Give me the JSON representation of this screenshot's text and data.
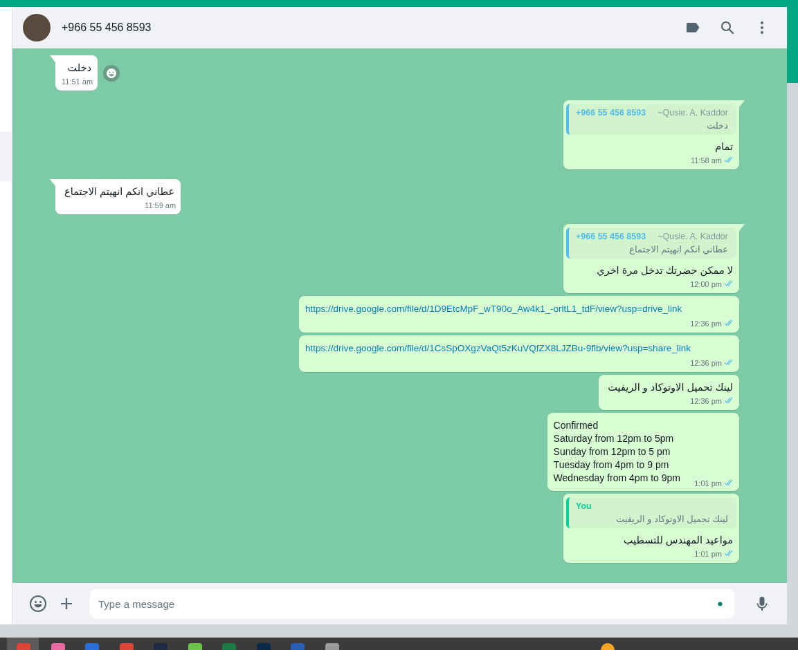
{
  "header": {
    "contact": "+966 55 456 8593"
  },
  "messages": [
    {
      "kind": "incoming",
      "tail": true,
      "rtl": true,
      "text": "دخلت",
      "time": "11:51 am",
      "reaction_button": true
    },
    {
      "kind": "outgoing",
      "tail": true,
      "rtl": true,
      "quote": {
        "author": "+966 55 456 8593",
        "sender_name": "~Qusie. A. Kaddor",
        "text": "دخلت",
        "color": "#53bdeb"
      },
      "text": "تمام",
      "time": "11:58 am",
      "read": true
    },
    {
      "kind": "incoming",
      "tail": true,
      "rtl": true,
      "text": "عطاني انكم انهيتم الاجتماع",
      "time": "11:59 am"
    },
    {
      "kind": "outgoing",
      "tail": true,
      "rtl": true,
      "quote": {
        "author": "+966 55 456 8593",
        "sender_name": "~Qusie. A. Kaddor",
        "text": "عطاني انكم انهيتم الاجتماع",
        "color": "#53bdeb"
      },
      "text": "لا ممكن حضرتك تدخل مرة اخري",
      "time": "12:00 pm",
      "read": true
    },
    {
      "kind": "outgoing",
      "tail": false,
      "link": true,
      "text": "https://drive.google.com/file/d/1D9EtcMpF_wT90o_Aw4k1_-orltL1_tdF/view?usp=drive_link",
      "time": "12:36 pm",
      "read": true
    },
    {
      "kind": "outgoing",
      "tail": false,
      "link": true,
      "text": "https://drive.google.com/file/d/1CsSpOXgzVaQt5zKuVQfZX8LJZBu-9flb/view?usp=share_link",
      "time": "12:36 pm",
      "read": true
    },
    {
      "kind": "outgoing",
      "tail": false,
      "rtl": true,
      "text": "لينك تحميل الاوتوكاد و الريفيت",
      "time": "12:36 pm",
      "read": true
    },
    {
      "kind": "outgoing",
      "tail": false,
      "text": "Confirmed\nSaturday from 12pm to 5pm\nSunday from 12pm to 5 pm\nTuesday from 4pm to 9 pm\nWednesday from 4pm to 9pm",
      "time": "1:01 pm",
      "read": true
    },
    {
      "kind": "outgoing",
      "tail": false,
      "rtl": true,
      "quote": {
        "author": "You",
        "text": "لينك تحميل الاوتوكاد و الريفيت",
        "color": "#06cf9c"
      },
      "text": "مواعيد المهندس للتسطيب",
      "time": "1:01 pm",
      "read": true
    }
  ],
  "composer": {
    "placeholder": "Type a message"
  }
}
